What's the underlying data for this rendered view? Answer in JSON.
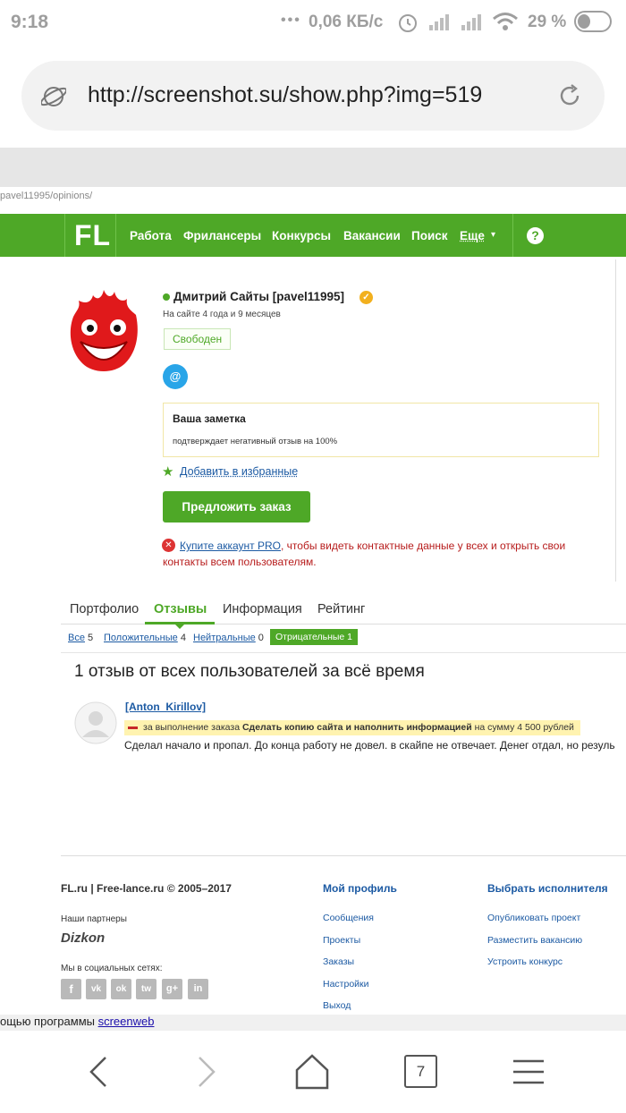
{
  "status": {
    "time": "9:18",
    "network": "0,06 КБ/с",
    "battery": "29 %"
  },
  "browser": {
    "url": "http://screenshot.su/show.php?img=519"
  },
  "page": {
    "url_hint": "pavel11995/opinions/"
  },
  "nav": {
    "logo": "FL",
    "items": [
      "Работа",
      "Фрилансеры",
      "Конкурсы",
      "Вакансии",
      "Поиск"
    ],
    "more": "Еще",
    "help": "?"
  },
  "profile": {
    "name": "Дмитрий Сайты [pavel11995]",
    "online": "На сайте 4 года и 9 месяцев",
    "status": "Свободен",
    "email_icon": "@",
    "note_title": "Ваша заметка",
    "note_text": "подтверждает негативный отзыв на 100%",
    "fav": "Добавить в избранные",
    "order_button": "Предложить заказ",
    "pro_link": "Купите аккаунт PRO",
    "pro_text": ", чтобы видеть контактные данные у всех и открыть свои",
    "pro_text2": "контакты всем пользователям."
  },
  "tabs": [
    "Портфолио",
    "Отзывы",
    "Информация",
    "Рейтинг"
  ],
  "filters": {
    "all_label": "Все",
    "all_count": "5",
    "pos_label": "Положительные",
    "pos_count": "4",
    "neu_label": "Нейтральные",
    "neu_count": "0",
    "neg_label": "Отрицательные 1"
  },
  "reviews": {
    "heading": "1 отзыв от всех пользователей за всё время",
    "author": "[Anton_Kirillov]",
    "order_prefix": "за выполнение заказа",
    "order_title": "Сделать копию сайта и наполнить информацией",
    "order_sum": "на сумму 4 500 рублей",
    "text": "Сделал начало и пропал. До конца работу не довел. в скайпе не отвечает.  Денег отдал, но резуль"
  },
  "footer": {
    "copyright": "FL.ru | Free-lance.ru © 2005–2017",
    "partners": "Наши партнеры",
    "partner_logo": "Dizkon",
    "social": "Мы в социальных сетях:",
    "social_icons": [
      "f",
      "vk",
      "ok",
      "tw",
      "g+",
      "in"
    ],
    "col1_title": "Мой профиль",
    "col1": [
      "Сообщения",
      "Проекты",
      "Заказы",
      "Настройки",
      "Выход"
    ],
    "col2_title": "Выбрать исполнителя",
    "col2": [
      "Опубликовать проект",
      "Разместить вакансию",
      "Устроить конкурс"
    ],
    "watermark_prefix": "ощью программы ",
    "watermark_link": "screenweb"
  },
  "navbar": {
    "tabs_count": "7"
  },
  "colors": {
    "green": "#4ea827",
    "link": "#1c5aa3",
    "red": "#c62828"
  }
}
